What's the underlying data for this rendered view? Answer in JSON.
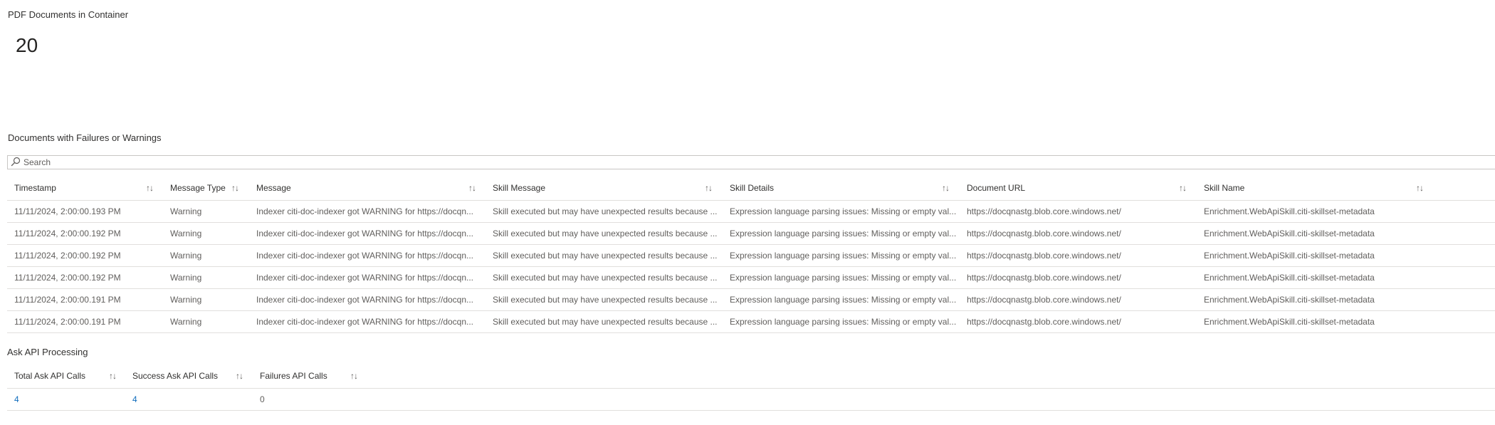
{
  "pdf_card": {
    "title": "PDF Documents in Container",
    "value": "20"
  },
  "failures_section": {
    "title": "Documents with Failures or Warnings",
    "search_placeholder": "Search",
    "columns": [
      "Timestamp",
      "Message Type",
      "Message",
      "Skill Message",
      "Skill Details",
      "Document URL",
      "Skill Name"
    ],
    "sort_icon": "↑↓",
    "rows": [
      [
        "11/11/2024, 2:00:00.193 PM",
        "Warning",
        "Indexer citi-doc-indexer got WARNING for https://docqn...",
        "Skill executed but may have unexpected results because ...",
        "Expression language parsing issues: Missing or empty val...",
        "https://docqnastg.blob.core.windows.net/",
        "Enrichment.WebApiSkill.citi-skillset-metadata"
      ],
      [
        "11/11/2024, 2:00:00.192 PM",
        "Warning",
        "Indexer citi-doc-indexer got WARNING for https://docqn...",
        "Skill executed but may have unexpected results because ...",
        "Expression language parsing issues: Missing or empty val...",
        "https://docqnastg.blob.core.windows.net/",
        "Enrichment.WebApiSkill.citi-skillset-metadata"
      ],
      [
        "11/11/2024, 2:00:00.192 PM",
        "Warning",
        "Indexer citi-doc-indexer got WARNING for https://docqn...",
        "Skill executed but may have unexpected results because ...",
        "Expression language parsing issues: Missing or empty val...",
        "https://docqnastg.blob.core.windows.net/",
        "Enrichment.WebApiSkill.citi-skillset-metadata"
      ],
      [
        "11/11/2024, 2:00:00.192 PM",
        "Warning",
        "Indexer citi-doc-indexer got WARNING for https://docqn...",
        "Skill executed but may have unexpected results because ...",
        "Expression language parsing issues: Missing or empty val...",
        "https://docqnastg.blob.core.windows.net/",
        "Enrichment.WebApiSkill.citi-skillset-metadata"
      ],
      [
        "11/11/2024, 2:00:00.191 PM",
        "Warning",
        "Indexer citi-doc-indexer got WARNING for https://docqn...",
        "Skill executed but may have unexpected results because ...",
        "Expression language parsing issues: Missing or empty val...",
        "https://docqnastg.blob.core.windows.net/",
        "Enrichment.WebApiSkill.citi-skillset-metadata"
      ],
      [
        "11/11/2024, 2:00:00.191 PM",
        "Warning",
        "Indexer citi-doc-indexer got WARNING for https://docqn...",
        "Skill executed but may have unexpected results because ...",
        "Expression language parsing issues: Missing or empty val...",
        "https://docqnastg.blob.core.windows.net/",
        "Enrichment.WebApiSkill.citi-skillset-metadata"
      ]
    ]
  },
  "ask_api_section": {
    "title": "Ask API Processing",
    "columns": [
      "Total Ask API Calls",
      "Success Ask API Calls",
      "Failures API Calls"
    ],
    "rows": [
      [
        "4",
        "4",
        "0"
      ]
    ]
  },
  "colors": {
    "text": "#323130",
    "muted": "#605e5c",
    "link": "#0f6cbd",
    "border": "#e1dfdd"
  },
  "icons": {
    "search": "search-icon",
    "sort": "sort-arrows-icon"
  }
}
